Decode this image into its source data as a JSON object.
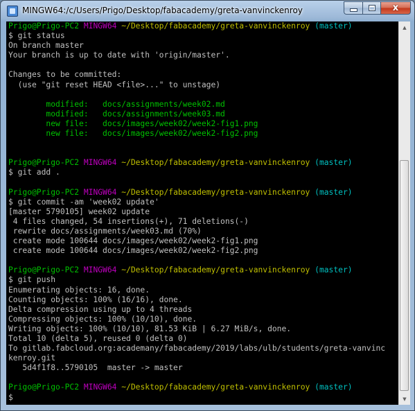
{
  "window": {
    "title": "MINGW64:/c/Users/Prigo/Desktop/fabacademy/greta-vanvinckenroy",
    "buttons": {
      "minimize": "",
      "maximize": "",
      "close": "x"
    }
  },
  "prompt": {
    "user_host": "Prigo@Prigo-PC2",
    "shell": "MINGW64",
    "path": "~/Desktop/fabacademy/greta-vanvinckenroy",
    "branch": "(master)",
    "symbol": "$"
  },
  "terminal": {
    "lines": [
      {
        "type": "prompt"
      },
      {
        "type": "cmd",
        "text": "$ git status"
      },
      {
        "type": "text",
        "text": "On branch master"
      },
      {
        "type": "text",
        "text": "Your branch is up to date with 'origin/master'."
      },
      {
        "type": "blank"
      },
      {
        "type": "text",
        "text": "Changes to be committed:"
      },
      {
        "type": "text",
        "text": "  (use \"git reset HEAD <file>...\" to unstage)"
      },
      {
        "type": "blank"
      },
      {
        "type": "green",
        "text": "        modified:   docs/assignments/week02.md"
      },
      {
        "type": "green",
        "text": "        modified:   docs/assignments/week03.md"
      },
      {
        "type": "green",
        "text": "        new file:   docs/images/week02/week2-fig1.png"
      },
      {
        "type": "green",
        "text": "        new file:   docs/images/week02/week2-fig2.png"
      },
      {
        "type": "blank"
      },
      {
        "type": "blank"
      },
      {
        "type": "prompt"
      },
      {
        "type": "cmd",
        "text": "$ git add ."
      },
      {
        "type": "blank"
      },
      {
        "type": "prompt"
      },
      {
        "type": "cmd",
        "text": "$ git commit -am 'week02 update'"
      },
      {
        "type": "text",
        "text": "[master 5790105] week02 update"
      },
      {
        "type": "text",
        "text": " 4 files changed, 54 insertions(+), 71 deletions(-)"
      },
      {
        "type": "text",
        "text": " rewrite docs/assignments/week03.md (70%)"
      },
      {
        "type": "text",
        "text": " create mode 100644 docs/images/week02/week2-fig1.png"
      },
      {
        "type": "text",
        "text": " create mode 100644 docs/images/week02/week2-fig2.png"
      },
      {
        "type": "blank"
      },
      {
        "type": "prompt"
      },
      {
        "type": "cmd",
        "text": "$ git push"
      },
      {
        "type": "text",
        "text": "Enumerating objects: 16, done."
      },
      {
        "type": "text",
        "text": "Counting objects: 100% (16/16), done."
      },
      {
        "type": "text",
        "text": "Delta compression using up to 4 threads"
      },
      {
        "type": "text",
        "text": "Compressing objects: 100% (10/10), done."
      },
      {
        "type": "text",
        "text": "Writing objects: 100% (10/10), 81.53 KiB | 6.27 MiB/s, done."
      },
      {
        "type": "text",
        "text": "Total 10 (delta 5), reused 0 (delta 0)"
      },
      {
        "type": "text",
        "text": "To gitlab.fabcloud.org:academany/fabacademy/2019/labs/ulb/students/greta-vanvinc"
      },
      {
        "type": "text",
        "text": "kenroy.git"
      },
      {
        "type": "text",
        "text": "   5d4f1f8..5790105  master -> master"
      },
      {
        "type": "blank"
      },
      {
        "type": "prompt"
      },
      {
        "type": "cmd",
        "text": "$"
      }
    ]
  },
  "colors": {
    "background": "#000000",
    "text": "#c0c0c0",
    "green": "#00c000",
    "magenta": "#c000c0",
    "yellow": "#c0c000",
    "cyan": "#00c0c0"
  }
}
